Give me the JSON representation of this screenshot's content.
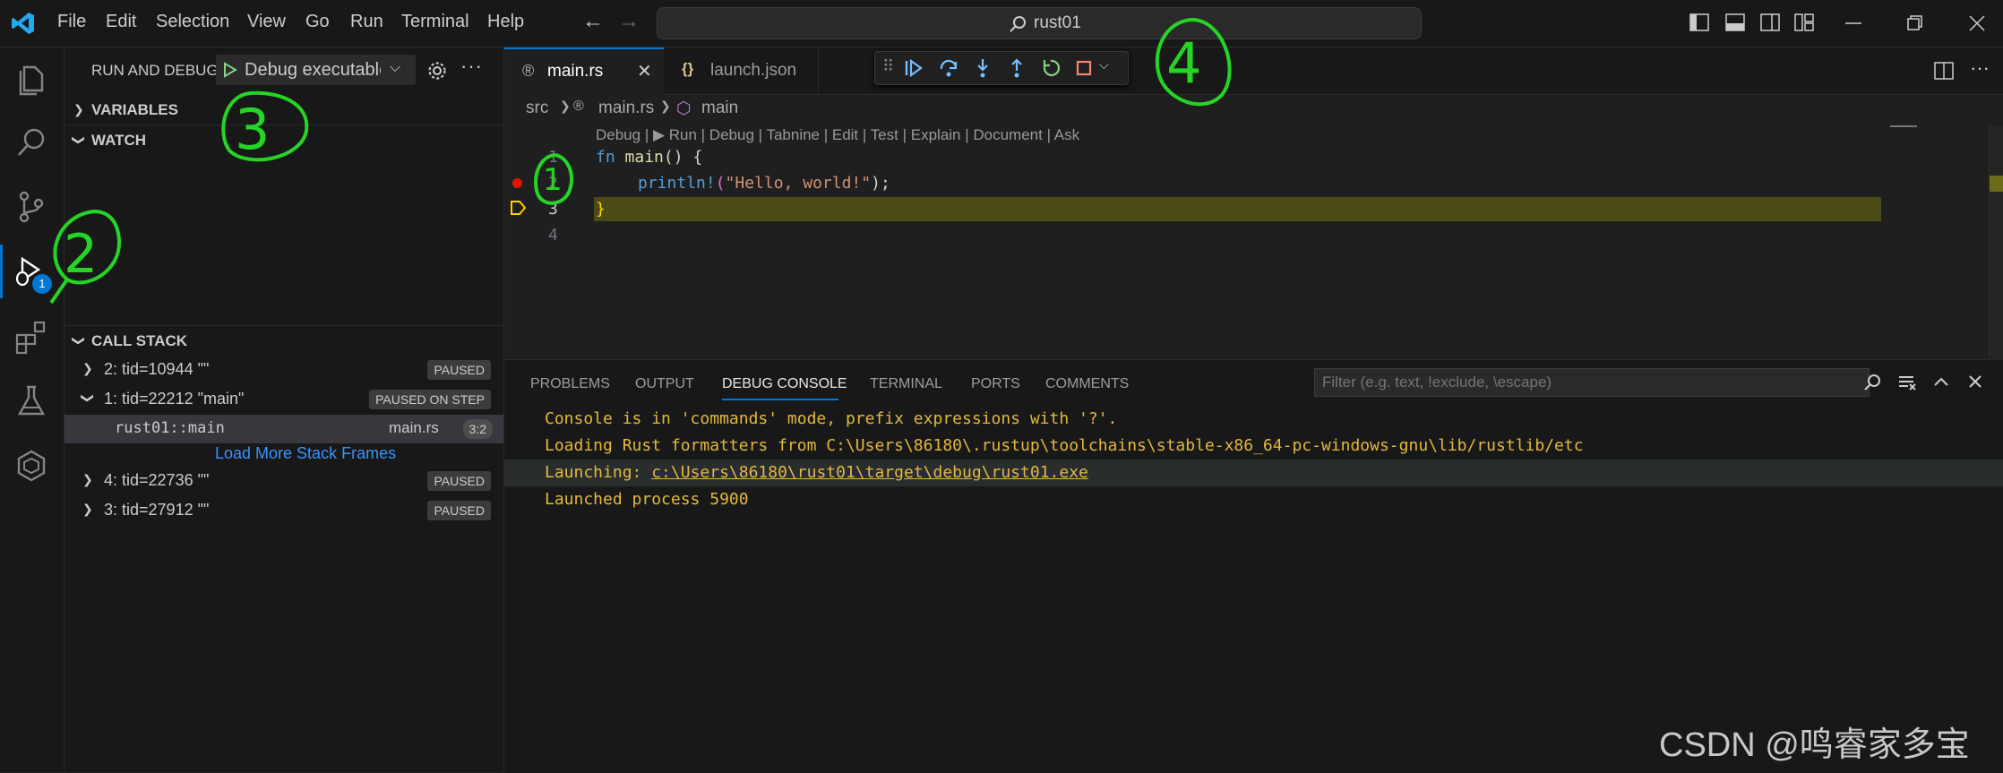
{
  "menu": [
    "File",
    "Edit",
    "Selection",
    "View",
    "Go",
    "Run",
    "Terminal",
    "Help"
  ],
  "command_center": {
    "text": "rust01"
  },
  "activity": {
    "debug_badge": "1"
  },
  "sidebar": {
    "title": "RUN AND DEBUG",
    "config": "Debug executable",
    "variables": "VARIABLES",
    "watch": "WATCH",
    "call_stack": "CALL STACK",
    "threads": [
      {
        "label": "2: tid=10944 \"\"",
        "badge": "PAUSED"
      },
      {
        "label": "1: tid=22212 \"main\"",
        "badge": "PAUSED ON STEP"
      },
      {
        "label": "4: tid=22736 \"\"",
        "badge": "PAUSED"
      },
      {
        "label": "3: tid=27912 \"\"",
        "badge": "PAUSED"
      }
    ],
    "frame": {
      "name": "rust01::main",
      "file": "main.rs",
      "pos": "3:2"
    },
    "load_more": "Load More Stack Frames"
  },
  "tabs": [
    {
      "icon": "®",
      "label": "main.rs",
      "active": true
    },
    {
      "icon": "{}",
      "label": "launch.json",
      "active": false
    }
  ],
  "breadcrumb": {
    "folder": "src",
    "file": "main.rs",
    "symbol": "main"
  },
  "codelens": "Debug | ▶ Run | Debug | Tabnine | Edit | Test | Explain | Document | Ask",
  "code": {
    "line_numbers": [
      "1",
      "2",
      "3",
      "4"
    ],
    "l1_kw": "fn",
    "l1_fn": "main",
    "l1_rest": "() {",
    "l2_macro": "println!",
    "l2_open": "(",
    "l2_str": "\"Hello, world!\"",
    "l2_close": ");",
    "l3": "}"
  },
  "panel": {
    "tabs": [
      "PROBLEMS",
      "OUTPUT",
      "DEBUG CONSOLE",
      "TERMINAL",
      "PORTS",
      "COMMENTS"
    ],
    "filter_placeholder": "Filter (e.g. text, !exclude, \\escape)",
    "lines": [
      "Console is in 'commands' mode, prefix expressions with '?'.",
      "Loading Rust formatters from C:\\Users\\86180\\.rustup\\toolchains\\stable-x86_64-pc-windows-gnu\\lib/rustlib/etc"
    ],
    "launching_label": "Launching: ",
    "launching_path": "c:\\Users\\86180\\rust01\\target\\debug\\rust01.exe",
    "launched": "Launched process 5900"
  },
  "watermark": "CSDN @鸣睿家多宝",
  "annotations": [
    "1",
    "2",
    "3",
    "4"
  ]
}
